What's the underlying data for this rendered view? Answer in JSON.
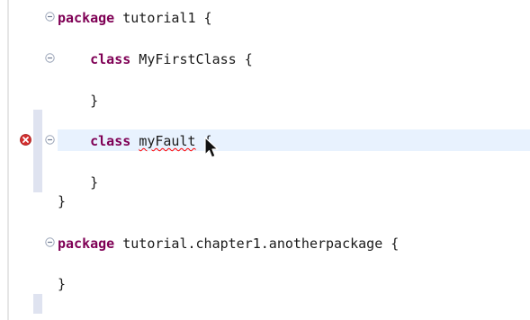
{
  "editor": {
    "lines": [
      {
        "keyword": "package",
        "text": " tutorial1 {"
      },
      {
        "indent": "    ",
        "keyword": "class",
        "text": " MyFirstClass {"
      },
      {
        "text": "    }"
      },
      {
        "indent": "    ",
        "keyword": "class",
        "text_before": " ",
        "error_text": "myFault",
        "text_after": " {"
      },
      {
        "text": "    }"
      },
      {
        "text": "}"
      },
      {
        "keyword": "package",
        "text": " tutorial.chapter1.anotherpackage {"
      },
      {
        "text": "}"
      }
    ]
  },
  "icons": {
    "fold": "collapse-fold-icon",
    "error": "error-marker-icon",
    "cursor": "mouse-pointer-icon"
  },
  "colors": {
    "keyword": "#7f0055",
    "text": "#1a1a1a",
    "current_line": "#e8f2fe",
    "error": "#d32f2f",
    "ruler_marker": "#dfe3f0",
    "gutter_border": "#e6e6e6"
  }
}
